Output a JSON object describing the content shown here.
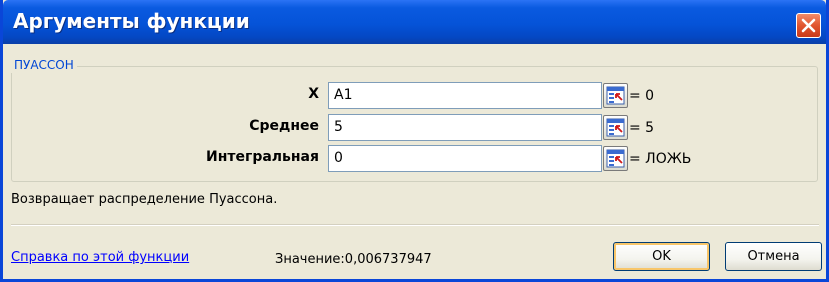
{
  "window": {
    "title": "Аргументы функции"
  },
  "function": {
    "name": "ПУАССОН"
  },
  "arguments": [
    {
      "label": "X",
      "value": "A1",
      "result": "= 0"
    },
    {
      "label": "Среднее",
      "value": "5",
      "result": "= 5"
    },
    {
      "label": "Интегральная",
      "value": "0",
      "result": "= ЛОЖЬ"
    }
  ],
  "description": "Возвращает распределение Пуассона.",
  "footer": {
    "help_link": "Справка по этой функции",
    "value_text": "Значение:0,006737947",
    "ok_label": "OK",
    "cancel_label": "Отмена"
  },
  "icons": {
    "close": "close-icon",
    "collapse": "collapse-dialog-icon"
  },
  "colors": {
    "titlebar": "#0553d8",
    "group_label": "#0046d5",
    "link": "#0000ff",
    "close_button": "#e1552f"
  }
}
